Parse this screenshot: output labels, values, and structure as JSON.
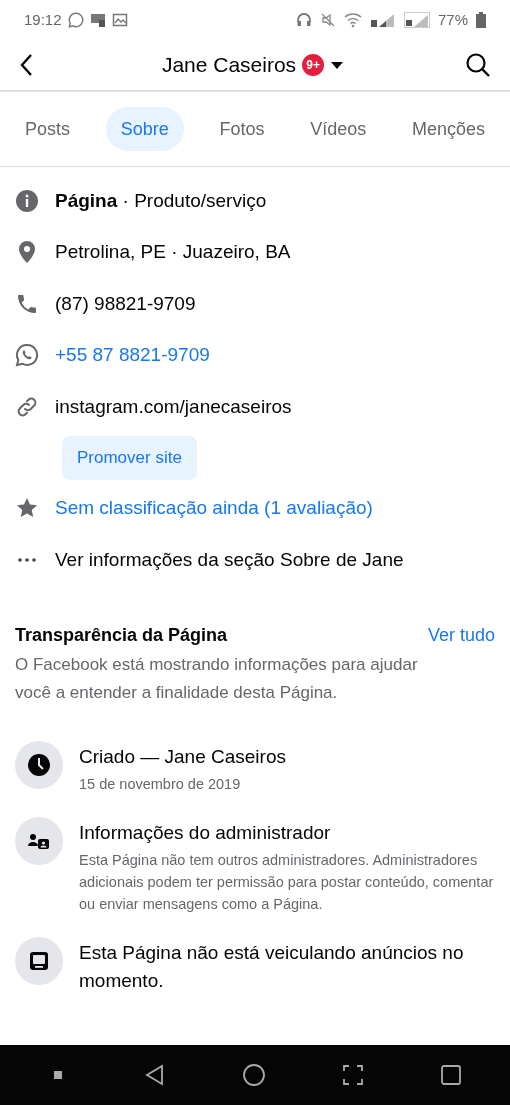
{
  "status_bar": {
    "time": "19:12",
    "battery": "77%"
  },
  "header": {
    "title": "Jane Caseiros",
    "badge": "9+"
  },
  "tabs": [
    {
      "label": "Posts",
      "selected": false
    },
    {
      "label": "Sobre",
      "selected": true
    },
    {
      "label": "Fotos",
      "selected": false
    },
    {
      "label": "Vídeos",
      "selected": false
    },
    {
      "label": "Menções",
      "selected": false
    }
  ],
  "about": [
    {
      "kind": "info",
      "text": "**Página** · Produto/serviço"
    },
    {
      "kind": "location",
      "text": "Petrolina, PE · Juazeiro, BA"
    },
    {
      "kind": "phone",
      "text": "(87) 98821-9709"
    },
    {
      "kind": "whatsapp",
      "text": "+55 87 8821-9709",
      "link": true
    },
    {
      "kind": "link",
      "text": "instagram.com/janecaseiros"
    },
    {
      "kind": "button",
      "text": "Promover site"
    },
    {
      "kind": "rating",
      "text": "Sem classificação ainda (1 avaliação)",
      "link": true
    },
    {
      "kind": "more",
      "text": "Ver informações da seção Sobre de Jane"
    }
  ],
  "transparency": {
    "title": "Transparência da Página",
    "see_all": "Ver tudo",
    "description": "O Facebook está mostrando informações para ajudar você a entender a finalidade desta Página.",
    "items": [
      {
        "kind": "clock",
        "title": "Criado — Jane Caseiros",
        "subtitle": "15 de novembro de 2019"
      },
      {
        "kind": "admin",
        "title": "Informações do administrador",
        "subtitle": "Esta Página não tem outros administradores. Administradores adicionais podem ter permissão para postar conteúdo, comentar ou enviar mensagens como a Página."
      },
      {
        "kind": "ads",
        "title": "Esta Página não está veiculando anúncios no momento."
      }
    ]
  }
}
